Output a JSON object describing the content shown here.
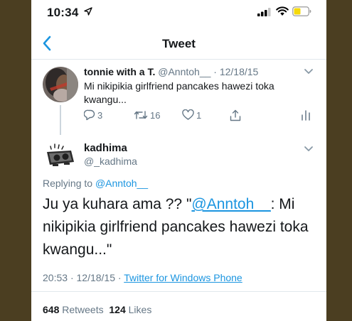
{
  "status_bar": {
    "time": "10:34"
  },
  "nav": {
    "title": "Tweet"
  },
  "parent_tweet": {
    "name": "tonnie with a T.",
    "handle": "@Anntoh__",
    "date": "12/18/15",
    "text": "Mi nikipikia girlfriend pancakes hawezi toka kwangu...",
    "replies": "3",
    "retweets": "16",
    "likes": "1"
  },
  "main_tweet": {
    "name": "kadhima",
    "handle": "@_kadhima",
    "replying_label": "Replying to",
    "replying_to": "@Anntoh__",
    "text_before": "Ju ya kuhara ama ?? \"",
    "mention": "@Anntoh__",
    "text_after": ": Mi nikipikia girlfriend pancakes hawezi toka kwangu...\"",
    "time": "20:53",
    "date": "12/18/15",
    "source": "Twitter for Windows Phone",
    "retweet_count": "648",
    "retweet_label": "Retweets",
    "like_count": "124",
    "like_label": "Likes"
  },
  "icons": {
    "back": "chevron-left-icon",
    "more": "chevron-down-icon",
    "reply": "reply-icon",
    "retweet": "retweet-icon",
    "like": "heart-icon",
    "share": "share-icon",
    "stats": "analytics-icon"
  },
  "colors": {
    "accent": "#1b95e0",
    "secondary_text": "#657786",
    "battery": "#f5d90a"
  }
}
